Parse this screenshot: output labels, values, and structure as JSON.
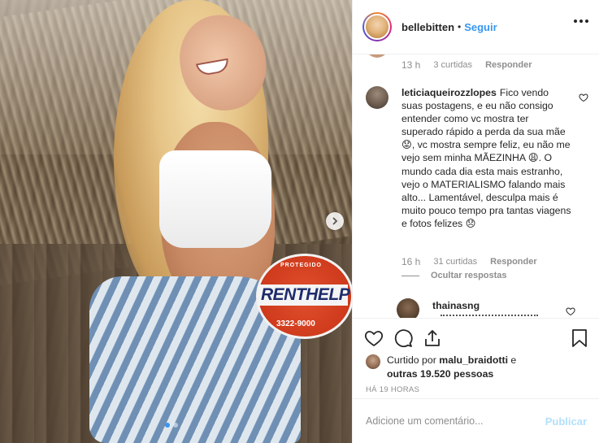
{
  "header": {
    "username": "bellebitten",
    "bullet": "•",
    "follow_label": "Seguir",
    "more_icon": "more-options-icon"
  },
  "photo": {
    "sign_top": "PROTEGIDO",
    "sign_brand": "RENTHELP",
    "sign_phone": "3322-9000",
    "carousel_next_icon": "chevron-right-icon",
    "carousel_total": 2,
    "carousel_active": 1
  },
  "prev_comment_meta": {
    "time": "13 h",
    "likes": "3 curtidas",
    "reply": "Responder"
  },
  "comment": {
    "username": "leticiaqueirozzlopes",
    "text": "Fico vendo suas postagens, e eu não consigo entender como vc mostra ter superado rápido a perda da sua mãe 😟, vc mostra sempre feliz, eu não me vejo sem minha MÃEZINHA 😩. O mundo cada dia esta mais estranho, vejo o MATERIALISMO falando mais alto... Lamentável, desculpa mais é muito pouco tempo pra tantas viagens e fotos felizes 😞",
    "time": "16 h",
    "likes": "31 curtidas",
    "reply": "Responder",
    "hide_replies": "Ocultar respostas"
  },
  "reply_comment": {
    "username": "thainasng"
  },
  "likes": {
    "prefix": "Curtido por",
    "user": "malu_braidotti",
    "connector": "e",
    "others": "outras 19.520 pessoas"
  },
  "timeago": "HÁ 19 HORAS",
  "add_comment": {
    "placeholder": "Adicione um comentário...",
    "publish_label": "Publicar"
  },
  "colors": {
    "accent": "#3897f0",
    "publish_disabled": "#b2dffc",
    "muted": "#8e8e8e"
  }
}
